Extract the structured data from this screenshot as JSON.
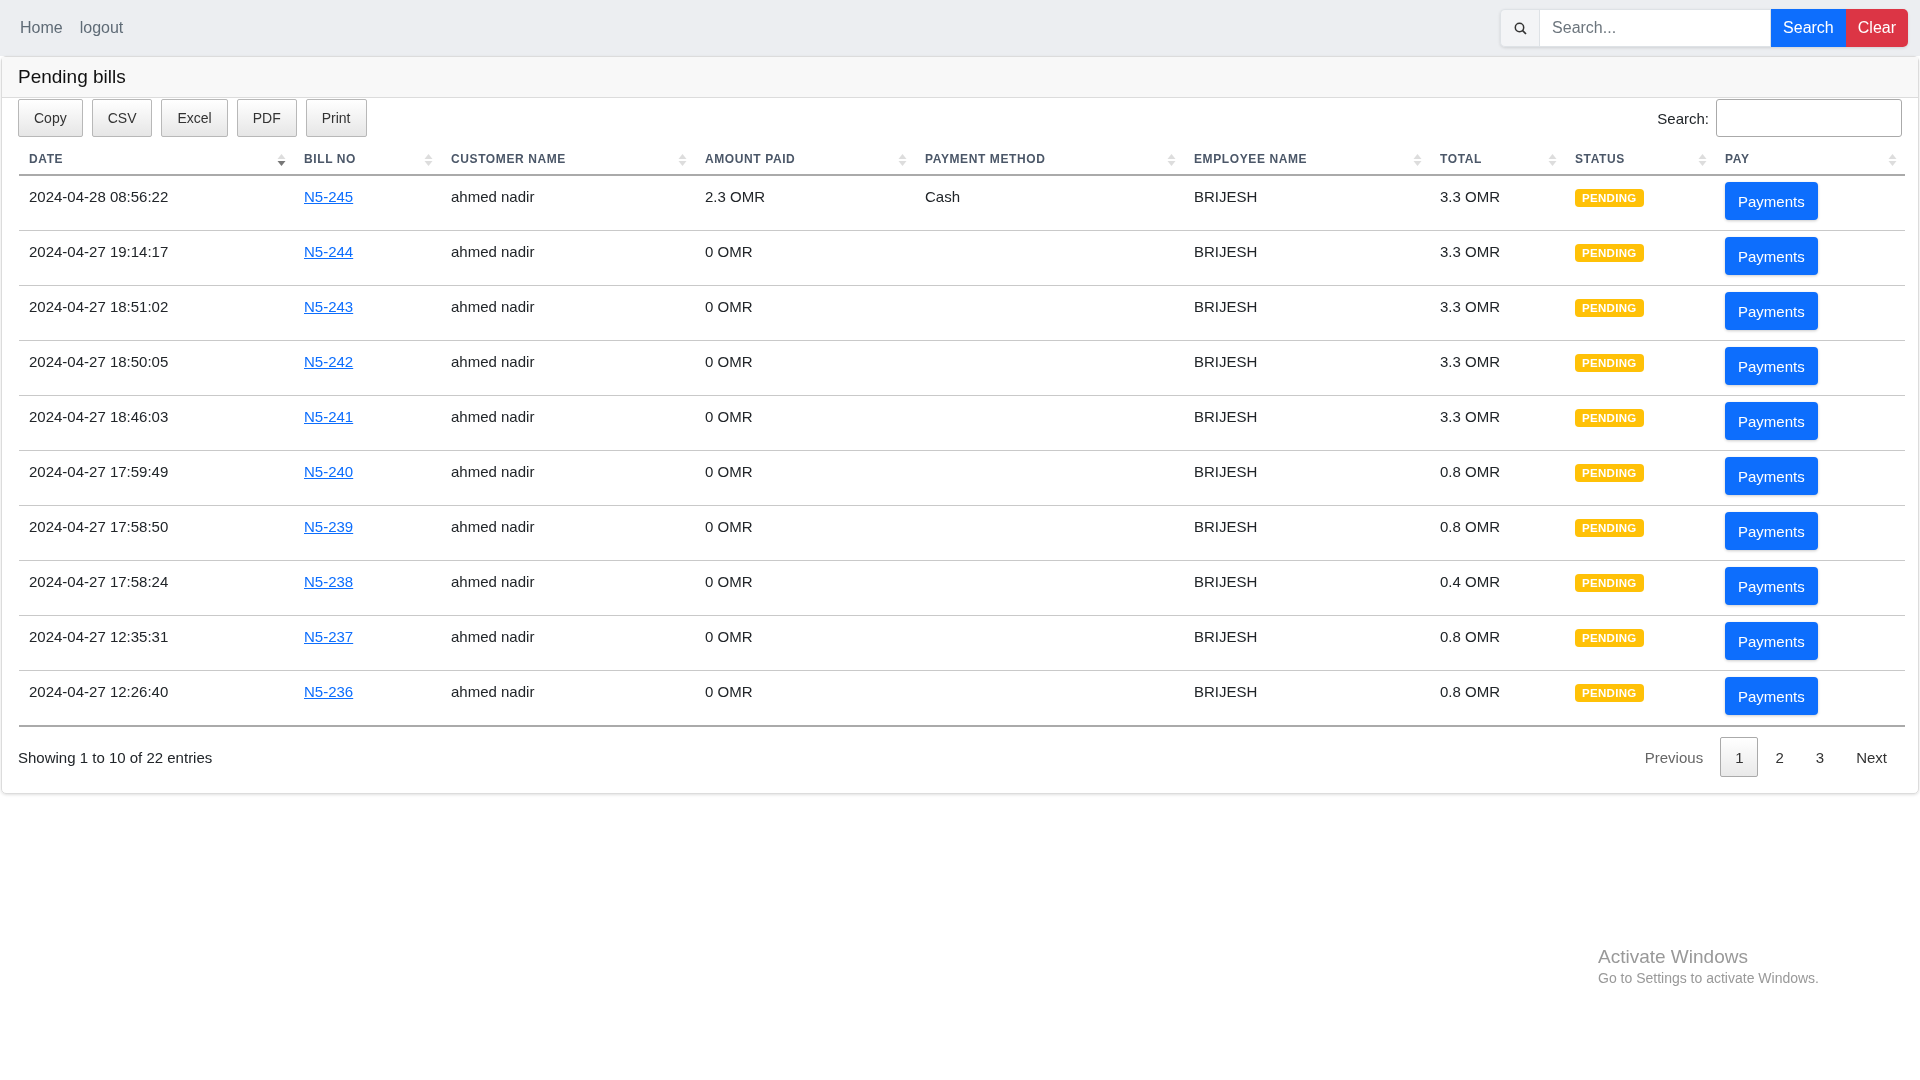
{
  "nav": {
    "links": [
      "Home",
      "logout"
    ],
    "search": {
      "placeholder": "Search..."
    },
    "buttons": [
      {
        "label": "Search",
        "kind": "primary"
      },
      {
        "label": "Clear",
        "kind": "danger"
      }
    ]
  },
  "card": {
    "title": "Pending bills",
    "export_buttons": [
      "Copy",
      "CSV",
      "Excel",
      "PDF",
      "Print"
    ],
    "filter": {
      "label": "Search:"
    },
    "table": {
      "columns": [
        {
          "label": "DATE",
          "sorted": true
        },
        {
          "label": "BILL NO",
          "sorted": false
        },
        {
          "label": "CUSTOMER NAME",
          "sorted": false
        },
        {
          "label": "AMOUNT PAID",
          "sorted": false
        },
        {
          "label": "PAYMENT METHOD",
          "sorted": false
        },
        {
          "label": "EMPLOYEE NAME",
          "sorted": false
        },
        {
          "label": "TOTAL",
          "sorted": false
        },
        {
          "label": "STATUS",
          "sorted": false
        },
        {
          "label": "PAY",
          "sorted": false
        }
      ],
      "rows": [
        {
          "date": "2024-04-28 08:56:22",
          "bill_no": "N5-245",
          "customer": "ahmed nadir",
          "amount_paid": "2.3 OMR",
          "payment_method": "Cash",
          "employee": "BRIJESH",
          "total": "3.3 OMR",
          "status": "PENDING",
          "action": "Payments"
        },
        {
          "date": "2024-04-27 19:14:17",
          "bill_no": "N5-244",
          "customer": "ahmed nadir",
          "amount_paid": "0 OMR",
          "employee": "BRIJESH",
          "total": "3.3 OMR",
          "status": "PENDING",
          "action": "Payments"
        },
        {
          "date": "2024-04-27 18:51:02",
          "bill_no": "N5-243",
          "customer": "ahmed nadir",
          "amount_paid": "0 OMR",
          "employee": "BRIJESH",
          "total": "3.3 OMR",
          "status": "PENDING",
          "action": "Payments"
        },
        {
          "date": "2024-04-27 18:50:05",
          "bill_no": "N5-242",
          "customer": "ahmed nadir",
          "amount_paid": "0 OMR",
          "employee": "BRIJESH",
          "total": "3.3 OMR",
          "status": "PENDING",
          "action": "Payments"
        },
        {
          "date": "2024-04-27 18:46:03",
          "bill_no": "N5-241",
          "customer": "ahmed nadir",
          "amount_paid": "0 OMR",
          "employee": "BRIJESH",
          "total": "3.3 OMR",
          "status": "PENDING",
          "action": "Payments"
        },
        {
          "date": "2024-04-27 17:59:49",
          "bill_no": "N5-240",
          "customer": "ahmed nadir",
          "amount_paid": "0 OMR",
          "employee": "BRIJESH",
          "total": "0.8 OMR",
          "status": "PENDING",
          "action": "Payments"
        },
        {
          "date": "2024-04-27 17:58:50",
          "bill_no": "N5-239",
          "customer": "ahmed nadir",
          "amount_paid": "0 OMR",
          "employee": "BRIJESH",
          "total": "0.8 OMR",
          "status": "PENDING",
          "action": "Payments"
        },
        {
          "date": "2024-04-27 17:58:24",
          "bill_no": "N5-238",
          "customer": "ahmed nadir",
          "amount_paid": "0 OMR",
          "employee": "BRIJESH",
          "total": "0.4 OMR",
          "status": "PENDING",
          "action": "Payments"
        },
        {
          "date": "2024-04-27 12:35:31",
          "bill_no": "N5-237",
          "customer": "ahmed nadir",
          "amount_paid": "0 OMR",
          "employee": "BRIJESH",
          "total": "0.8 OMR",
          "status": "PENDING",
          "action": "Payments"
        },
        {
          "date": "2024-04-27 12:26:40",
          "bill_no": "N5-236",
          "customer": "ahmed nadir",
          "amount_paid": "0 OMR",
          "employee": "BRIJESH",
          "total": "0.8 OMR",
          "status": "PENDING",
          "action": "Payments"
        }
      ]
    },
    "info": "Showing 1 to 10 of 22 entries",
    "pagination": {
      "previous": {
        "label": "Previous",
        "disabled": true
      },
      "pages": [
        {
          "label": "1",
          "selected": true
        },
        {
          "label": "2",
          "selected": false
        },
        {
          "label": "3",
          "selected": false
        }
      ],
      "next": {
        "label": "Next",
        "disabled": false
      }
    }
  },
  "os_notice": {
    "title": "Activate Windows",
    "text": "Go to Settings to activate Windows."
  }
}
